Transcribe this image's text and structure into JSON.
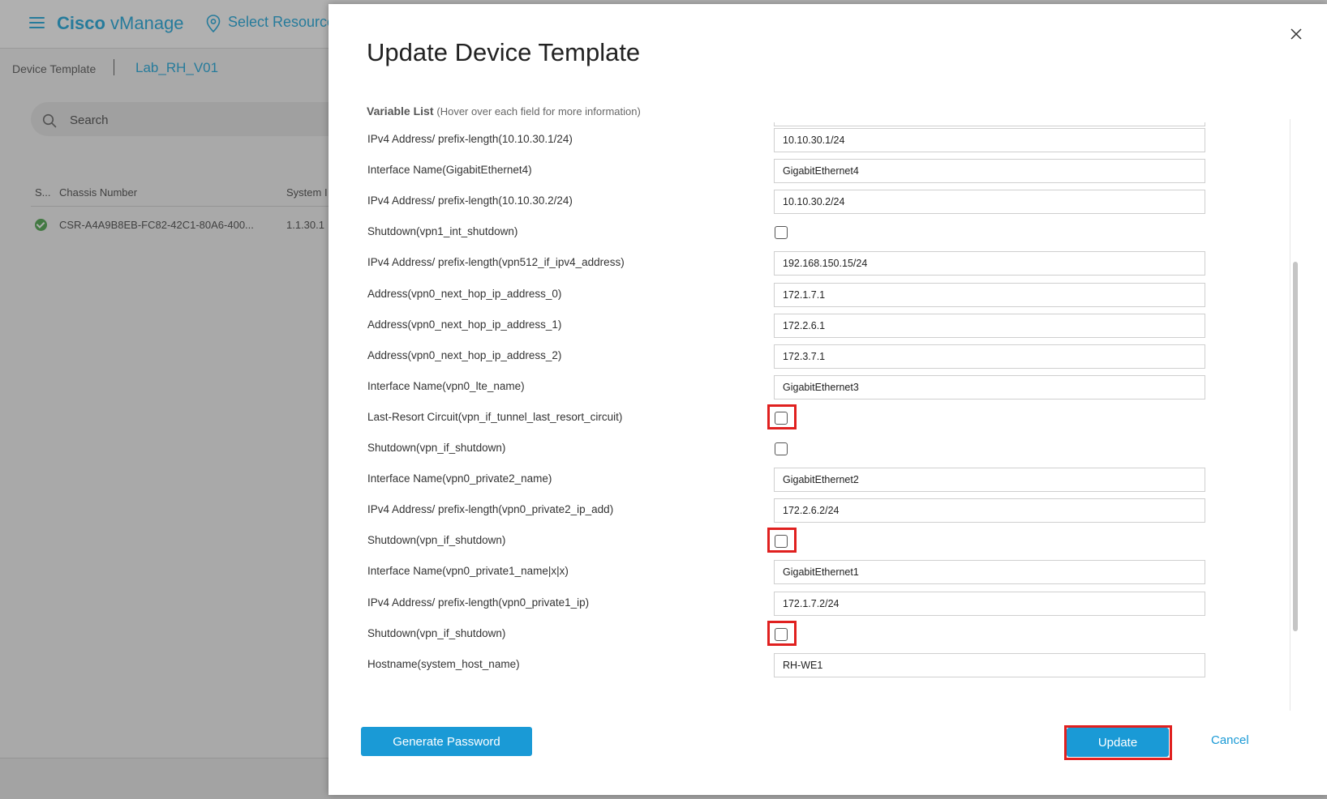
{
  "background": {
    "brand_bold": "Cisco",
    "brand_rest": " vManage",
    "select_resource": "Select Resource",
    "breadcrumb": {
      "parent": "Device Template",
      "current": "Lab_RH_V01"
    },
    "search_placeholder": "Search",
    "table": {
      "headers": [
        "S...",
        "Chassis Number",
        "System I"
      ],
      "rows": [
        {
          "status": "ok",
          "chassis": "CSR-A4A9B8EB-FC82-42C1-80A6-400...",
          "system_ip": "1.1.30.1"
        }
      ]
    }
  },
  "modal": {
    "title": "Update Device Template",
    "variable_list_title": "Variable List",
    "variable_list_hint": "(Hover over each field for more information)",
    "rows": [
      {
        "label": "IPv4 Address/ prefix-length(10.10.30.1/24)",
        "type": "text",
        "value": "10.10.30.1/24"
      },
      {
        "label": "Interface Name(GigabitEthernet4)",
        "type": "text",
        "value": "GigabitEthernet4"
      },
      {
        "label": "IPv4 Address/ prefix-length(10.10.30.2/24)",
        "type": "text",
        "value": "10.10.30.2/24"
      },
      {
        "label": "Shutdown(vpn1_int_shutdown)",
        "type": "checkbox",
        "checked": false,
        "highlighted": false
      },
      {
        "label": "IPv4 Address/ prefix-length(vpn512_if_ipv4_address)",
        "type": "text",
        "value": "192.168.150.15/24"
      },
      {
        "label": "Address(vpn0_next_hop_ip_address_0)",
        "type": "text",
        "value": "172.1.7.1"
      },
      {
        "label": "Address(vpn0_next_hop_ip_address_1)",
        "type": "text",
        "value": "172.2.6.1"
      },
      {
        "label": "Address(vpn0_next_hop_ip_address_2)",
        "type": "text",
        "value": "172.3.7.1"
      },
      {
        "label": "Interface Name(vpn0_lte_name)",
        "type": "text",
        "value": "GigabitEthernet3"
      },
      {
        "label": "Last-Resort Circuit(vpn_if_tunnel_last_resort_circuit)",
        "type": "checkbox",
        "checked": false,
        "highlighted": true
      },
      {
        "label": "Shutdown(vpn_if_shutdown)",
        "type": "checkbox",
        "checked": false,
        "highlighted": false
      },
      {
        "label": "Interface Name(vpn0_private2_name)",
        "type": "text",
        "value": "GigabitEthernet2"
      },
      {
        "label": "IPv4 Address/ prefix-length(vpn0_private2_ip_add)",
        "type": "text",
        "value": "172.2.6.2/24"
      },
      {
        "label": "Shutdown(vpn_if_shutdown)",
        "type": "checkbox",
        "checked": false,
        "highlighted": true
      },
      {
        "label": "Interface Name(vpn0_private1_name|x|x)",
        "type": "text",
        "value": "GigabitEthernet1"
      },
      {
        "label": "IPv4 Address/ prefix-length(vpn0_private1_ip)",
        "type": "text",
        "value": "172.1.7.2/24"
      },
      {
        "label": "Shutdown(vpn_if_shutdown)",
        "type": "checkbox",
        "checked": false,
        "highlighted": true
      },
      {
        "label": "Hostname(system_host_name)",
        "type": "text",
        "value": "RH-WE1"
      }
    ],
    "buttons": {
      "generate_password": "Generate Password",
      "update": "Update",
      "cancel": "Cancel"
    }
  },
  "colors": {
    "accent": "#1a9ad6",
    "brand": "#049fd9",
    "highlight": "#e0201f",
    "status_ok": "#3a9b3a"
  },
  "icons": {
    "menu": "hamburger-icon",
    "location": "map-pin-icon",
    "search": "search-icon",
    "close": "close-icon",
    "status": "check-circle-icon"
  }
}
